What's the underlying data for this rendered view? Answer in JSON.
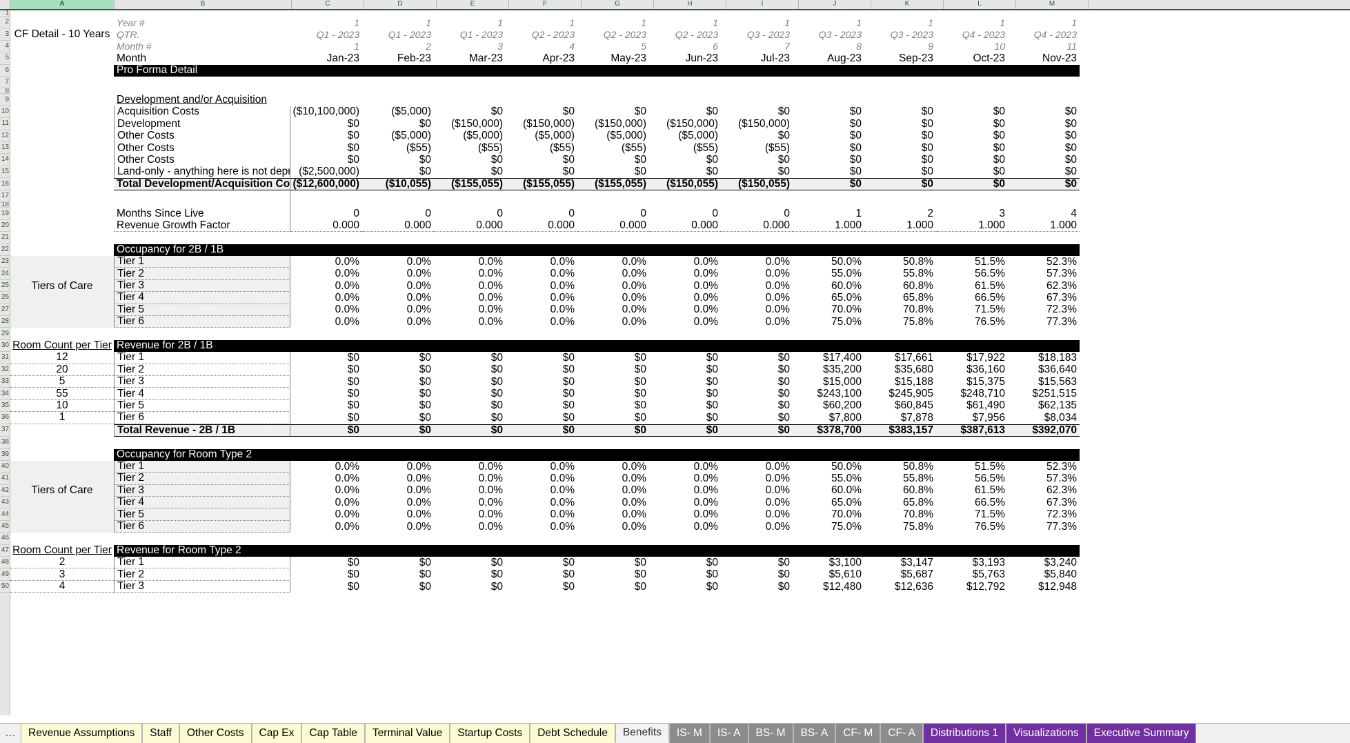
{
  "app": {
    "type": "spreadsheet",
    "sheet_title": "CF Detail - 10 Years"
  },
  "column_headers": [
    "A",
    "B",
    "C",
    "D",
    "E",
    "F",
    "G",
    "H",
    "I",
    "J",
    "K",
    "L",
    "M"
  ],
  "selected_column": "A",
  "row_numbers": [
    "1",
    "2",
    "3",
    "4",
    "5",
    "6",
    "7",
    "8",
    "9",
    "10",
    "11",
    "12",
    "13",
    "14",
    "15",
    "16",
    "17",
    "18",
    "19",
    "20",
    "21",
    "22",
    "23",
    "24",
    "25",
    "26",
    "27",
    "28",
    "29",
    "30",
    "31",
    "32",
    "33",
    "34",
    "35",
    "36",
    "37",
    "38",
    "39",
    "40",
    "41",
    "42",
    "43",
    "44",
    "45",
    "46",
    "47",
    "48"
  ],
  "header": {
    "labels": {
      "year": "Year #",
      "qtr": "QTR.",
      "month_num": "Month #",
      "month": "Month"
    },
    "year": [
      "1",
      "1",
      "1",
      "1",
      "1",
      "1",
      "1",
      "1",
      "1",
      "1",
      "1"
    ],
    "qtr": [
      "Q1 - 2023",
      "Q1 - 2023",
      "Q1 - 2023",
      "Q2 - 2023",
      "Q2 - 2023",
      "Q2 - 2023",
      "Q3 - 2023",
      "Q3 - 2023",
      "Q3 - 2023",
      "Q4 - 2023",
      "Q4 - 2023"
    ],
    "month_num": [
      "1",
      "2",
      "3",
      "4",
      "5",
      "6",
      "7",
      "8",
      "9",
      "10",
      "11"
    ],
    "month": [
      "Jan-23",
      "Feb-23",
      "Mar-23",
      "Apr-23",
      "May-23",
      "Jun-23",
      "Jul-23",
      "Aug-23",
      "Sep-23",
      "Oct-23",
      "Nov-23"
    ]
  },
  "sections": {
    "pro_forma_detail": "Pro Forma Detail",
    "development_heading": "Development and/or Acquisition",
    "occupancy_2b1b": "Occupancy for 2B / 1B",
    "revenue_2b1b": "Revenue for 2B / 1B",
    "occupancy_rt2": "Occupancy for Room Type 2",
    "revenue_rt2": "Revenue for Room Type 2",
    "tiers_of_care": "Tiers of Care",
    "room_count_per_tier": "Room Count per Tier"
  },
  "development_rows": [
    {
      "label": "Acquisition Costs",
      "values": [
        "($10,100,000)",
        "($5,000)",
        "$0",
        "$0",
        "$0",
        "$0",
        "$0",
        "$0",
        "$0",
        "$0",
        "$0"
      ]
    },
    {
      "label": "Development",
      "values": [
        "$0",
        "$0",
        "($150,000)",
        "($150,000)",
        "($150,000)",
        "($150,000)",
        "($150,000)",
        "$0",
        "$0",
        "$0",
        "$0"
      ]
    },
    {
      "label": "Other Costs",
      "values": [
        "$0",
        "($5,000)",
        "($5,000)",
        "($5,000)",
        "($5,000)",
        "($5,000)",
        "$0",
        "$0",
        "$0",
        "$0",
        "$0"
      ]
    },
    {
      "label": "Other Costs",
      "values": [
        "$0",
        "($55)",
        "($55)",
        "($55)",
        "($55)",
        "($55)",
        "($55)",
        "$0",
        "$0",
        "$0",
        "$0"
      ]
    },
    {
      "label": "Other Costs",
      "values": [
        "$0",
        "$0",
        "$0",
        "$0",
        "$0",
        "$0",
        "$0",
        "$0",
        "$0",
        "$0",
        "$0"
      ]
    },
    {
      "label": "Land-only - anything here is not depreciable",
      "values": [
        "($2,500,000)",
        "$0",
        "$0",
        "$0",
        "$0",
        "$0",
        "$0",
        "$0",
        "$0",
        "$0",
        "$0"
      ]
    }
  ],
  "development_total": {
    "label": "Total Development/Acquisition Costs",
    "values": [
      "($12,600,000)",
      "($10,055)",
      "($155,055)",
      "($155,055)",
      "($155,055)",
      "($150,055)",
      "($150,055)",
      "$0",
      "$0",
      "$0",
      "$0"
    ]
  },
  "growth_rows": [
    {
      "label": "Months Since Live",
      "values": [
        "0",
        "0",
        "0",
        "0",
        "0",
        "0",
        "0",
        "1",
        "2",
        "3",
        "4"
      ]
    },
    {
      "label": "Revenue Growth Factor",
      "values": [
        "0.000",
        "0.000",
        "0.000",
        "0.000",
        "0.000",
        "0.000",
        "0.000",
        "1.000",
        "1.000",
        "1.000",
        "1.000"
      ]
    }
  ],
  "occupancy_2b1b_rows": [
    {
      "label": "Tier 1",
      "values": [
        "0.0%",
        "0.0%",
        "0.0%",
        "0.0%",
        "0.0%",
        "0.0%",
        "0.0%",
        "50.0%",
        "50.8%",
        "51.5%",
        "52.3%"
      ]
    },
    {
      "label": "Tier 2",
      "values": [
        "0.0%",
        "0.0%",
        "0.0%",
        "0.0%",
        "0.0%",
        "0.0%",
        "0.0%",
        "55.0%",
        "55.8%",
        "56.5%",
        "57.3%"
      ]
    },
    {
      "label": "Tier 3",
      "values": [
        "0.0%",
        "0.0%",
        "0.0%",
        "0.0%",
        "0.0%",
        "0.0%",
        "0.0%",
        "60.0%",
        "60.8%",
        "61.5%",
        "62.3%"
      ]
    },
    {
      "label": "Tier 4",
      "values": [
        "0.0%",
        "0.0%",
        "0.0%",
        "0.0%",
        "0.0%",
        "0.0%",
        "0.0%",
        "65.0%",
        "65.8%",
        "66.5%",
        "67.3%"
      ]
    },
    {
      "label": "Tier 5",
      "values": [
        "0.0%",
        "0.0%",
        "0.0%",
        "0.0%",
        "0.0%",
        "0.0%",
        "0.0%",
        "70.0%",
        "70.8%",
        "71.5%",
        "72.3%"
      ]
    },
    {
      "label": "Tier 6",
      "values": [
        "0.0%",
        "0.0%",
        "0.0%",
        "0.0%",
        "0.0%",
        "0.0%",
        "0.0%",
        "75.0%",
        "75.8%",
        "76.5%",
        "77.3%"
      ]
    }
  ],
  "revenue_2b1b_rows": [
    {
      "room_count": "12",
      "label": "Tier 1",
      "values": [
        "$0",
        "$0",
        "$0",
        "$0",
        "$0",
        "$0",
        "$0",
        "$17,400",
        "$17,661",
        "$17,922",
        "$18,183"
      ]
    },
    {
      "room_count": "20",
      "label": "Tier 2",
      "values": [
        "$0",
        "$0",
        "$0",
        "$0",
        "$0",
        "$0",
        "$0",
        "$35,200",
        "$35,680",
        "$36,160",
        "$36,640"
      ]
    },
    {
      "room_count": "5",
      "label": "Tier 3",
      "values": [
        "$0",
        "$0",
        "$0",
        "$0",
        "$0",
        "$0",
        "$0",
        "$15,000",
        "$15,188",
        "$15,375",
        "$15,563"
      ]
    },
    {
      "room_count": "55",
      "label": "Tier 4",
      "values": [
        "$0",
        "$0",
        "$0",
        "$0",
        "$0",
        "$0",
        "$0",
        "$243,100",
        "$245,905",
        "$248,710",
        "$251,515"
      ]
    },
    {
      "room_count": "10",
      "label": "Tier 5",
      "values": [
        "$0",
        "$0",
        "$0",
        "$0",
        "$0",
        "$0",
        "$0",
        "$60,200",
        "$60,845",
        "$61,490",
        "$62,135"
      ]
    },
    {
      "room_count": "1",
      "label": "Tier 6",
      "values": [
        "$0",
        "$0",
        "$0",
        "$0",
        "$0",
        "$0",
        "$0",
        "$7,800",
        "$7,878",
        "$7,956",
        "$8,034"
      ]
    }
  ],
  "revenue_2b1b_total": {
    "label": "Total Revenue - 2B / 1B",
    "values": [
      "$0",
      "$0",
      "$0",
      "$0",
      "$0",
      "$0",
      "$0",
      "$378,700",
      "$383,157",
      "$387,613",
      "$392,070"
    ]
  },
  "occupancy_rt2_rows": [
    {
      "label": "Tier 1",
      "values": [
        "0.0%",
        "0.0%",
        "0.0%",
        "0.0%",
        "0.0%",
        "0.0%",
        "0.0%",
        "50.0%",
        "50.8%",
        "51.5%",
        "52.3%"
      ]
    },
    {
      "label": "Tier 2",
      "values": [
        "0.0%",
        "0.0%",
        "0.0%",
        "0.0%",
        "0.0%",
        "0.0%",
        "0.0%",
        "55.0%",
        "55.8%",
        "56.5%",
        "57.3%"
      ]
    },
    {
      "label": "Tier 3",
      "values": [
        "0.0%",
        "0.0%",
        "0.0%",
        "0.0%",
        "0.0%",
        "0.0%",
        "0.0%",
        "60.0%",
        "60.8%",
        "61.5%",
        "62.3%"
      ]
    },
    {
      "label": "Tier 4",
      "values": [
        "0.0%",
        "0.0%",
        "0.0%",
        "0.0%",
        "0.0%",
        "0.0%",
        "0.0%",
        "65.0%",
        "65.8%",
        "66.5%",
        "67.3%"
      ]
    },
    {
      "label": "Tier 5",
      "values": [
        "0.0%",
        "0.0%",
        "0.0%",
        "0.0%",
        "0.0%",
        "0.0%",
        "0.0%",
        "70.0%",
        "70.8%",
        "71.5%",
        "72.3%"
      ]
    },
    {
      "label": "Tier 6",
      "values": [
        "0.0%",
        "0.0%",
        "0.0%",
        "0.0%",
        "0.0%",
        "0.0%",
        "0.0%",
        "75.0%",
        "75.8%",
        "76.5%",
        "77.3%"
      ]
    }
  ],
  "revenue_rt2_rows": [
    {
      "room_count": "2",
      "label": "Tier 1",
      "values": [
        "$0",
        "$0",
        "$0",
        "$0",
        "$0",
        "$0",
        "$0",
        "$3,100",
        "$3,147",
        "$3,193",
        "$3,240"
      ]
    },
    {
      "room_count": "3",
      "label": "Tier 2",
      "values": [
        "$0",
        "$0",
        "$0",
        "$0",
        "$0",
        "$0",
        "$0",
        "$5,610",
        "$5,687",
        "$5,763",
        "$5,840"
      ]
    },
    {
      "room_count": "4",
      "label": "Tier 3",
      "values": [
        "$0",
        "$0",
        "$0",
        "$0",
        "$0",
        "$0",
        "$0",
        "$12,480",
        "$12,636",
        "$12,792",
        "$12,948"
      ]
    }
  ],
  "tabs": [
    {
      "label": "Revenue Assumptions",
      "style": "yellow"
    },
    {
      "label": "Staff",
      "style": "yellow"
    },
    {
      "label": "Other Costs",
      "style": "yellow"
    },
    {
      "label": "Cap Ex",
      "style": "yellow"
    },
    {
      "label": "Cap Table",
      "style": "yellow"
    },
    {
      "label": "Terminal Value",
      "style": "yellow"
    },
    {
      "label": "Startup Costs",
      "style": "yellow"
    },
    {
      "label": "Debt Schedule",
      "style": "yellow"
    },
    {
      "label": "Benefits",
      "style": "active"
    },
    {
      "label": "IS- M",
      "style": "grey"
    },
    {
      "label": "IS- A",
      "style": "grey"
    },
    {
      "label": "BS- M",
      "style": "grey"
    },
    {
      "label": "BS- A",
      "style": "grey"
    },
    {
      "label": "CF- M",
      "style": "grey"
    },
    {
      "label": "CF- A",
      "style": "grey"
    },
    {
      "label": "Distributions 1",
      "style": "purple"
    },
    {
      "label": "Visualizations",
      "style": "purple"
    },
    {
      "label": "Executive Summary",
      "style": "purple"
    }
  ],
  "tab_overflow_icon": "ellipsis-icon",
  "colors": {
    "selected_header": "#a9dfbf",
    "header_text": "#375623",
    "section_bar": "#000000",
    "tab_yellow": "#fdfbd4",
    "tab_grey": "#8c8c8c",
    "tab_purple": "#7030a0"
  }
}
